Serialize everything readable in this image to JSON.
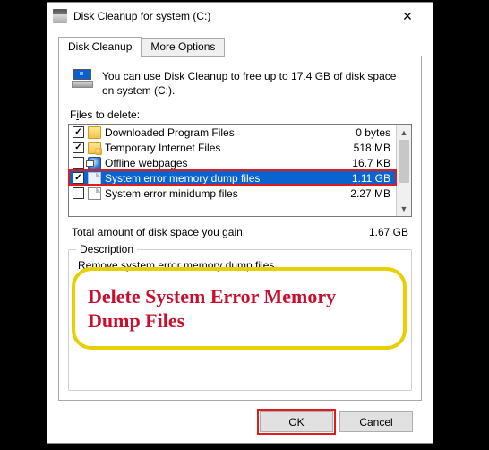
{
  "window": {
    "title": "Disk Cleanup for system (C:)"
  },
  "tabs": {
    "active": "Disk Cleanup",
    "inactive": "More Options"
  },
  "summary": "You can use Disk Cleanup to free up to 17.4 GB of disk space on system (C:).",
  "files_label_pre": "F",
  "files_label_hot": "i",
  "files_label_post": "les to delete:",
  "items": [
    {
      "checked": true,
      "icon": "folder",
      "name": "Downloaded Program Files",
      "size": "0 bytes"
    },
    {
      "checked": true,
      "icon": "lock",
      "name": "Temporary Internet Files",
      "size": "518 MB"
    },
    {
      "checked": false,
      "icon": "globe",
      "name": "Offline webpages",
      "size": "16.7 KB"
    },
    {
      "checked": true,
      "icon": "file",
      "name": "System error memory dump files",
      "size": "1.11 GB"
    },
    {
      "checked": false,
      "icon": "file",
      "name": "System error minidump files",
      "size": "2.27 MB"
    }
  ],
  "selected_index": 3,
  "total_label": "Total amount of disk space you gain:",
  "total_value": "1.67 GB",
  "description": {
    "legend": "Description",
    "text": "Remove system error memory dump files."
  },
  "annotation": "Delete System Error Memory Dump Files",
  "buttons": {
    "ok": "OK",
    "cancel": "Cancel"
  }
}
